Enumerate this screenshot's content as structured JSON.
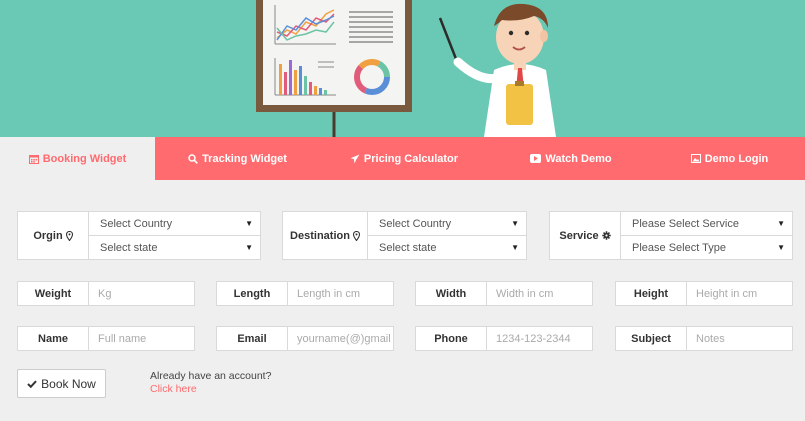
{
  "colors": {
    "accent": "#ff6b6f",
    "hero_bg": "#6ac9b4",
    "page_bg": "#efefef"
  },
  "tabs": [
    {
      "label": "Booking Widget",
      "icon": "calendar-icon",
      "active": true
    },
    {
      "label": "Tracking Widget",
      "icon": "search-icon"
    },
    {
      "label": "Pricing Calculator",
      "icon": "plane-icon"
    },
    {
      "label": "Watch Demo",
      "icon": "play-icon"
    },
    {
      "label": "Demo Login",
      "icon": "image-icon"
    }
  ],
  "origin": {
    "label": "Orgin",
    "icon": "map-marker-icon",
    "country": "Select Country",
    "state": "Select state"
  },
  "destination": {
    "label": "Destination",
    "icon": "map-marker-icon",
    "country": "Select Country",
    "state": "Select state"
  },
  "service": {
    "label": "Service",
    "icon": "gear-icon",
    "service": "Please Select Service",
    "type": "Please Select Type"
  },
  "dimensions": {
    "weight": {
      "label": "Weight",
      "placeholder": "Kg"
    },
    "length": {
      "label": "Length",
      "placeholder": "Length in cm"
    },
    "width": {
      "label": "Width",
      "placeholder": "Width in cm"
    },
    "height": {
      "label": "Height",
      "placeholder": "Height in cm"
    }
  },
  "contact": {
    "name": {
      "label": "Name",
      "placeholder": "Full name"
    },
    "email": {
      "label": "Email",
      "placeholder": "yourname(@)gmail"
    },
    "phone": {
      "label": "Phone",
      "placeholder": "1234-123-2344"
    },
    "subject": {
      "label": "Subject",
      "placeholder": "Notes"
    }
  },
  "actions": {
    "book_now": "Book Now",
    "book_icon": "check-icon",
    "account_prompt": "Already have an account?",
    "click_here": "Click here"
  }
}
